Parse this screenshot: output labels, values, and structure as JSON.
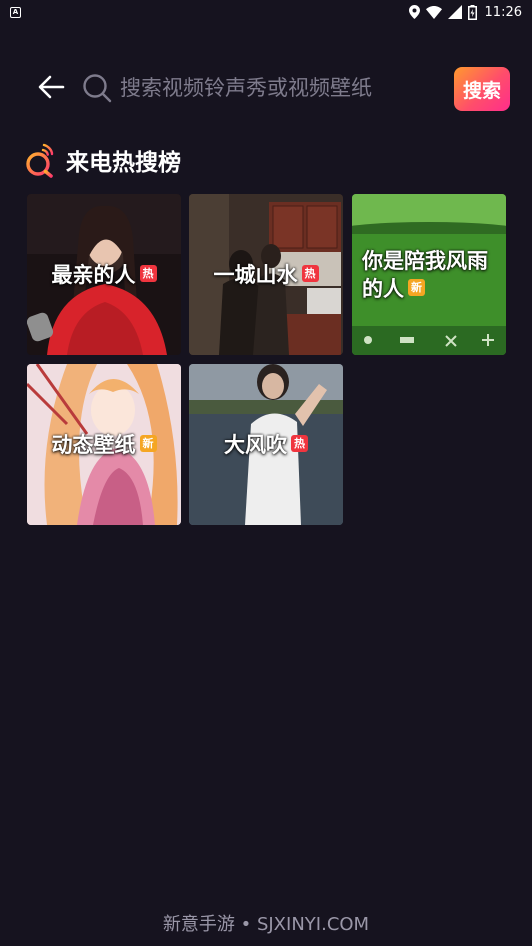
{
  "status_bar": {
    "time": "11:26",
    "notification_icon": "app-notification-icon",
    "icons": [
      "location-icon",
      "wifi-icon",
      "signal-icon",
      "battery-icon"
    ]
  },
  "search": {
    "placeholder": "搜索视频铃声秀或视频壁纸",
    "value": "",
    "button_label": "搜索"
  },
  "section": {
    "title": "来电热搜榜",
    "icon": "hot-search-icon",
    "accent_color": "#ff6a3d"
  },
  "tiles": [
    {
      "label": "最亲的人",
      "badge": "热",
      "badge_type": "hot"
    },
    {
      "label": "一城山水",
      "badge": "热",
      "badge_type": "hot"
    },
    {
      "label": "你是陪我风雨的人",
      "badge": "新",
      "badge_type": "new"
    },
    {
      "label": "动态壁纸",
      "badge": "新",
      "badge_type": "new"
    },
    {
      "label": "大风吹",
      "badge": "热",
      "badge_type": "hot"
    }
  ],
  "colors": {
    "background": "#16131f",
    "hot_badge": "#f0353f",
    "new_badge": "#f5a623",
    "search_button_gradient": [
      "#ff9a2e",
      "#ff2d8c"
    ]
  },
  "footer": {
    "watermark": "新意手游 • SJXINYI.COM"
  }
}
